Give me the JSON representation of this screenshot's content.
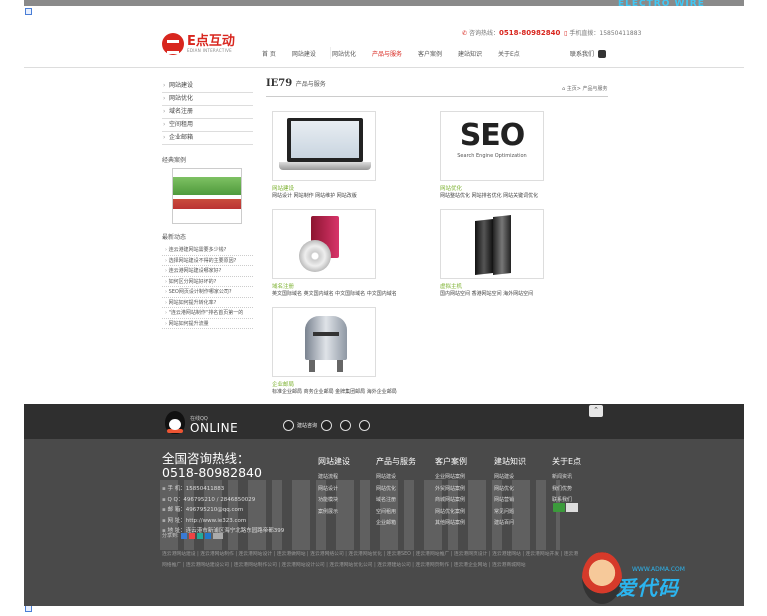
{
  "window": {
    "watermark_top": "ELECTRO WIRE"
  },
  "header": {
    "logo_cn": "E点互动",
    "logo_en": "EDIAN INTERACTIVE",
    "hotline_label": "咨询热线：",
    "hotline": "0518-80982840",
    "mobile": "手机直拨：15850411883",
    "nav": [
      "首 页",
      "网站建设",
      "网站优化",
      "产品与服务",
      "客户案例",
      "建站知识",
      "关于E点"
    ],
    "active_nav": "产品与服务",
    "contact": "联系我们"
  },
  "sidebar": {
    "items": [
      "网站建设",
      "网站优化",
      "域名注册",
      "空间租用",
      "企业邮箱"
    ],
    "case_title": "经典案例",
    "news_title": "最新动态",
    "news": [
      "连云港建网站需要多少钱?",
      "选择网站建设不得的主要原因?",
      "连云港网站建设哪家好?",
      "如何区分网站好坏的?",
      "SEO网页设计制作哪家公司?",
      "网站如何提升转化率?",
      "\"连云港网站制作\"排名首页第一的",
      "网站如何提升流量"
    ]
  },
  "main": {
    "title": "IE79",
    "subtitle": "产品与服务",
    "breadcrumb": "主页> 产品与服务",
    "products": [
      {
        "name": "网站建设",
        "desc": "网站设计 网站制作 网站维护 网站改版",
        "icon": "laptop-icon"
      },
      {
        "name": "网站优化",
        "desc": "网站整站优化 网站排名优化 网站关键词优化",
        "icon": "seo-icon"
      },
      {
        "name": "域名注册",
        "desc": "英文国际域名 英文国内域名 中文国际域名 中文国内域名",
        "icon": "software-box-icon"
      },
      {
        "name": "虚拟主机",
        "desc": "国内网站空间 香港网站空间 海外网站空间",
        "icon": "server-icon"
      },
      {
        "name": "企业邮局",
        "desc": "标准企业邮局 商务企业邮局 金牌集团邮局 海外企业邮局",
        "icon": "mailbox-icon"
      }
    ],
    "seo_text": "SEO",
    "seo_sub": "Search Engine Optimization"
  },
  "footer": {
    "online_small": "在线QQ",
    "online": "ONLINE",
    "services": [
      "建站咨询"
    ],
    "hotline_title": "全国咨询热线：",
    "hotline": "0518-80982840",
    "info": [
      "手 机：15850411883",
      "Q Q：496795210 / 2846850029",
      "邮 箱：496795210@qq.com",
      "网 址：http://www.ie323.com",
      "地 址：连云港市新浦区海宁北路东园路帝都399"
    ],
    "share": "分享到:",
    "columns": [
      {
        "title": "网站建设",
        "items": [
          "建站流程",
          "网站设计",
          "功能模块",
          "案例展示"
        ]
      },
      {
        "title": "产品与服务",
        "items": [
          "网站建设",
          "网站优化",
          "域名注册",
          "空间租用",
          "企业邮箱"
        ]
      },
      {
        "title": "客户案例",
        "items": [
          "企业网站案例",
          "外贸网站案例",
          "商城网站案例",
          "网站优化案例",
          "其他网站案例"
        ]
      },
      {
        "title": "建站知识",
        "items": [
          "网站建设",
          "网站优化",
          "网站营销",
          "常见问题",
          "建站百问"
        ]
      },
      {
        "title": "关于E点",
        "items": [
          "新闻资讯",
          "我们优势",
          "联系我们"
        ]
      }
    ],
    "links": "连云港网站建设 | 连云港网站制作 | 连云港网站设计 | 连云港做网站 | 连云港网络公司 | 连云港网站优化 | 连云港SEO | 连云港网站推广 | 连云港网页设计 | 连云港建网站 | 连云港网站开发 | 连云港网络推广 | 连云港网站建设公司 | 连云港网站制作公司 | 连云港网站设计公司 | 连云港网站优化公司 | 连云港建站公司 | 连云港网页制作 | 连云港企业网站 | 连云港商城网站"
  },
  "watermark": {
    "text": "爱代码",
    "sub": "WWW.ADMA.COM"
  }
}
